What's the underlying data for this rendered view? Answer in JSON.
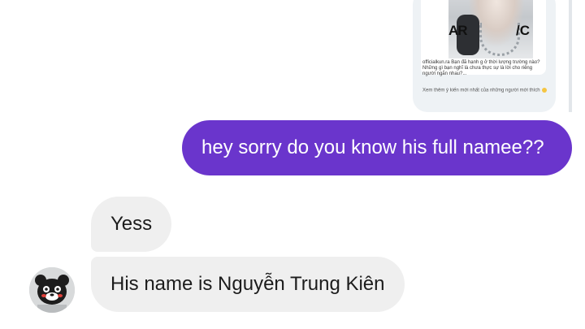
{
  "shared_post": {
    "photo_text_left": "AR",
    "photo_text_right": "/C",
    "caption": "officialkun.ra Bạn đã hạnh g ở thời lượng trường nào? Những gì bạn nghĩ là chưa thực sự là lời cho riêng người ngắn nhau?...",
    "footer": "Xem thêm ý kiến mới nhất của những người mới thích"
  },
  "messages": [
    {
      "direction": "outgoing",
      "text": "hey sorry do you know his full namee??"
    },
    {
      "direction": "incoming",
      "text": "Yess"
    },
    {
      "direction": "incoming",
      "text": "His name is Nguyễn Trung Kiên"
    }
  ],
  "avatar": {
    "icon": "bear-mascot-avatar"
  },
  "colors": {
    "outgoing_bubble": "#6a35cc",
    "incoming_bubble": "#efefef",
    "shared_card": "#eef2f5"
  }
}
